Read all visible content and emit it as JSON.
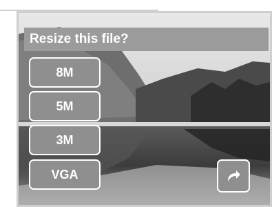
{
  "dialog": {
    "title": "Resize this file?"
  },
  "options": [
    {
      "label": "8M"
    },
    {
      "label": "5M"
    },
    {
      "label": "3M"
    },
    {
      "label": "VGA"
    }
  ],
  "icons": {
    "back": "return-arrow-icon"
  },
  "colors": {
    "title_bar": "#9b9b9b",
    "button_fill": "#8f8f8f",
    "button_border": "#ffffff",
    "frame_border": "#cfcfcf"
  }
}
